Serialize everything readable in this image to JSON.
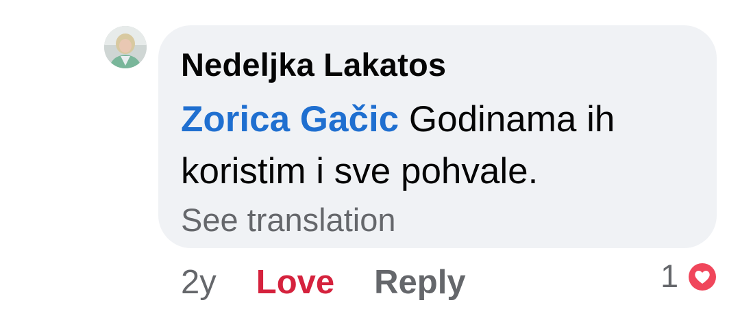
{
  "comment": {
    "author": "Nedeljka Lakatos",
    "mention": "Zorica Gačic",
    "text": " Godinama ih koristim i sve pohvale.",
    "see_translation": "See translation"
  },
  "actions": {
    "timestamp": "2y",
    "love_label": "Love",
    "reply_label": "Reply"
  },
  "reactions": {
    "count": "1",
    "icon": "love-reaction-icon"
  },
  "colors": {
    "bubble": "#f0f2f5",
    "mention": "#1f6fd0",
    "love": "#d5223d",
    "secondary_text": "#65676b"
  }
}
